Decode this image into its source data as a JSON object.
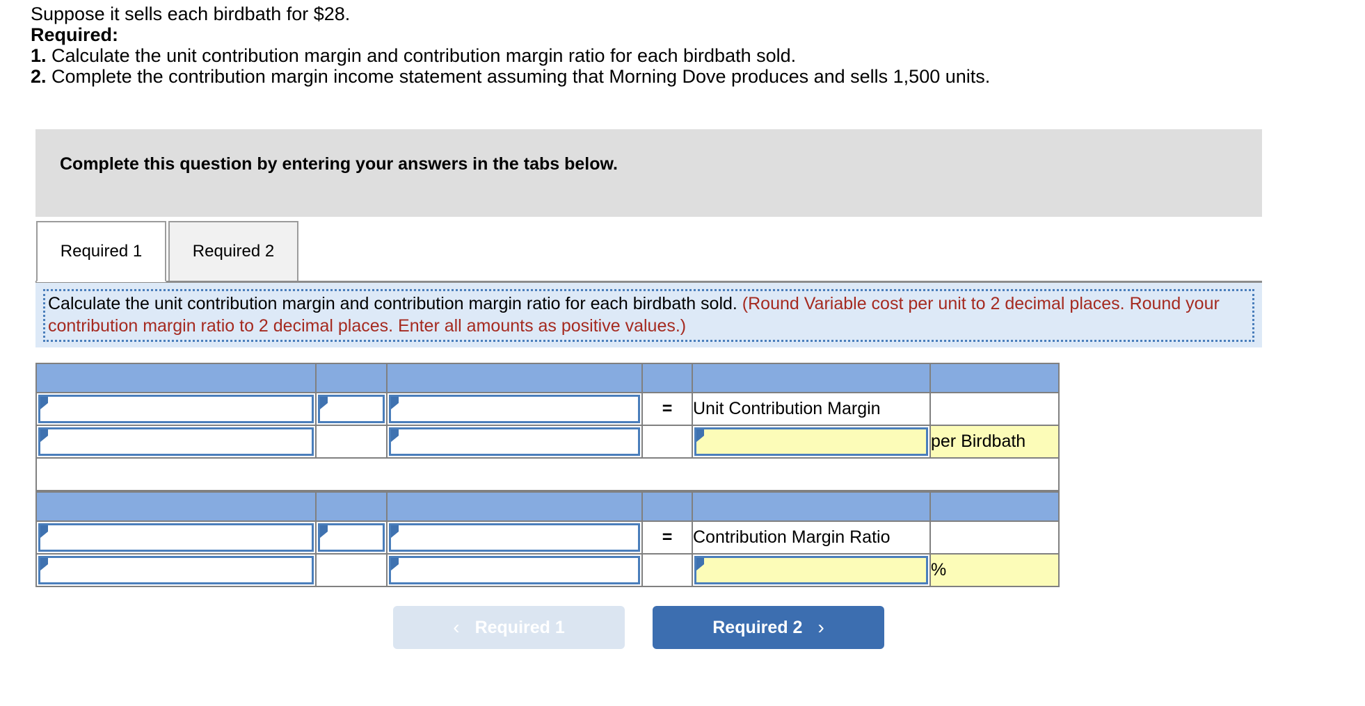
{
  "problem": {
    "lines": [
      {
        "text": "Suppose it sells each birdbath for $28.",
        "bold": false
      },
      {
        "text": "Required:",
        "bold": true
      },
      {
        "prefix": "1.",
        "text": " Calculate the unit contribution margin and contribution margin ratio for each birdbath sold."
      },
      {
        "prefix": "2.",
        "text": " Complete the contribution margin income statement assuming that Morning Dove produces and sells 1,500 units."
      }
    ],
    "line1": "Suppose it sells each birdbath for $28.",
    "required_label": "Required:",
    "item1_number": "1.",
    "item1_text": " Calculate the unit contribution margin and contribution margin ratio for each birdbath sold.",
    "item2_number": "2.",
    "item2_text": " Complete the contribution margin income statement assuming that Morning Dove produces and sells 1,500 units."
  },
  "banner": {
    "text": "Complete this question by entering your answers in the tabs below.",
    "background": "#dedede"
  },
  "tabs": [
    {
      "label": "Required 1",
      "active": true
    },
    {
      "label": "Required 2",
      "active": false
    }
  ],
  "tab_labels": {
    "tab1": "Required 1",
    "tab2": "Required 2"
  },
  "requirement_panel": {
    "black_text": "Calculate the unit contribution margin and contribution margin ratio for each birdbath sold. ",
    "red_text": "(Round Variable cost per unit to 2 decimal places. Round your contribution margin ratio to 2 decimal places. Enter all amounts as positive values.)",
    "red_color": "#a52a20",
    "background": "#dde9f7",
    "border_color": "#4a7ebb"
  },
  "colors": {
    "table_header_blue": "#86abe0",
    "input_yellow": "#fcfcb8",
    "input_border_blue": "#4a7ebb",
    "table_border_gray": "#808080",
    "primary_button": "#3c6eb0",
    "disabled_button": "#dbe5f1"
  },
  "table1": {
    "header_cells": [
      "",
      "",
      "",
      "",
      "",
      ""
    ],
    "rows": [
      {
        "type": "input-row",
        "cells": [
          {
            "kind": "dropdown",
            "value": ""
          },
          {
            "kind": "dropdown",
            "value": ""
          },
          {
            "kind": "dropdown",
            "value": ""
          },
          {
            "kind": "operator",
            "value": "="
          },
          {
            "kind": "label",
            "value": "Unit Contribution Margin"
          },
          {
            "kind": "blank",
            "value": ""
          }
        ]
      },
      {
        "type": "input-row",
        "cells": [
          {
            "kind": "dropdown",
            "value": ""
          },
          {
            "kind": "blank",
            "value": ""
          },
          {
            "kind": "dropdown",
            "value": ""
          },
          {
            "kind": "blank",
            "value": ""
          },
          {
            "kind": "yellow-input",
            "value": ""
          },
          {
            "kind": "yellow-label",
            "value": "per Birdbath"
          }
        ]
      }
    ]
  },
  "table2": {
    "header_cells": [
      "",
      "",
      "",
      "",
      "",
      ""
    ],
    "rows": [
      {
        "type": "input-row",
        "cells": [
          {
            "kind": "dropdown",
            "value": ""
          },
          {
            "kind": "dropdown",
            "value": ""
          },
          {
            "kind": "dropdown",
            "value": ""
          },
          {
            "kind": "operator",
            "value": "="
          },
          {
            "kind": "label",
            "value": "Contribution Margin Ratio"
          },
          {
            "kind": "blank",
            "value": ""
          }
        ]
      },
      {
        "type": "input-row",
        "cells": [
          {
            "kind": "dropdown",
            "value": ""
          },
          {
            "kind": "blank",
            "value": ""
          },
          {
            "kind": "dropdown",
            "value": ""
          },
          {
            "kind": "blank",
            "value": ""
          },
          {
            "kind": "yellow-input",
            "value": ""
          },
          {
            "kind": "yellow-label",
            "value": "%"
          }
        ]
      }
    ]
  },
  "cells": {
    "unit_contribution_margin_label": "Unit Contribution Margin",
    "per_birdbath_label": "per Birdbath",
    "contribution_margin_ratio_label": "Contribution Margin Ratio",
    "percent_label": "%",
    "equals_1": "=",
    "equals_2": "="
  },
  "nav": {
    "prev_label": "Required 1",
    "prev_icon": "chevron-left",
    "prev_chevron": "‹",
    "next_label": "Required 2",
    "next_icon": "chevron-right",
    "next_chevron": "›"
  }
}
